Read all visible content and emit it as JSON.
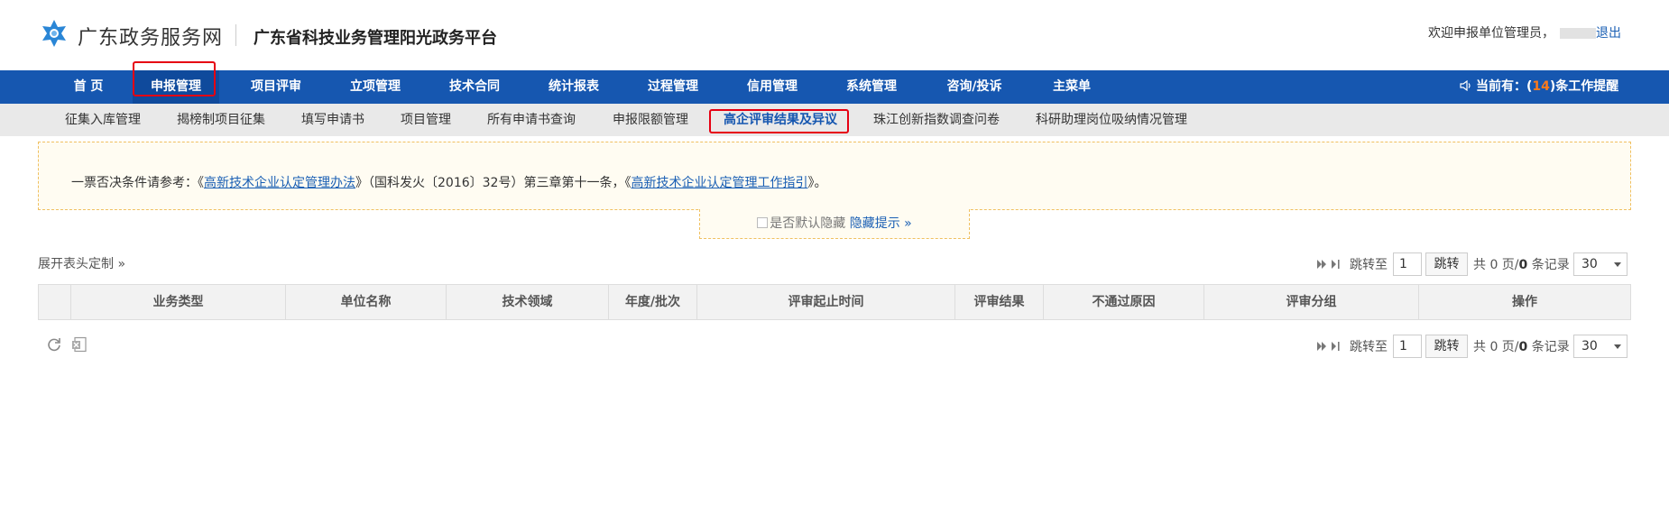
{
  "header": {
    "logo_text": "广东政务服务网",
    "platform_title": "广东省科技业务管理阳光政务平台",
    "welcome": "欢迎申报单位管理员，",
    "logout": "退出"
  },
  "main_nav": {
    "items": [
      "首 页",
      "申报管理",
      "项目评审",
      "立项管理",
      "技术合同",
      "统计报表",
      "过程管理",
      "信用管理",
      "系统管理",
      "咨询/投诉",
      "主菜单"
    ],
    "active": "申报管理"
  },
  "reminder": {
    "prefix": "当前有：(",
    "count": "14",
    "suffix": ")条工作提醒"
  },
  "sub_nav": {
    "items": [
      "征集入库管理",
      "揭榜制项目征集",
      "填写申请书",
      "项目管理",
      "所有申请书查询",
      "申报限额管理",
      "高企评审结果及异议",
      "珠江创新指数调查问卷",
      "科研助理岗位吸纳情况管理"
    ],
    "active": "高企评审结果及异议"
  },
  "notice": {
    "lead": "一票否决条件请参考：《",
    "link1": "高新技术企业认定管理办法",
    "middle": "》（国科发火〔2016〕32号）第三章第十一条，《",
    "link2": "高新技术企业认定管理工作指引",
    "tail": "》。",
    "checkbox_label": "是否默认隐藏",
    "hide_link": "隐藏提示 »"
  },
  "table": {
    "expand_label": "展开表头定制 »",
    "columns": [
      "业务类型",
      "单位名称",
      "技术领域",
      "年度/批次",
      "评审起止时间",
      "评审结果",
      "不通过原因",
      "评审分组",
      "操作"
    ]
  },
  "pager": {
    "jump_to": "跳转至",
    "page_value": "1",
    "jump_button": "跳转",
    "total_prefix": "共 0 页/",
    "total_records": "0",
    "total_suffix": " 条记录",
    "page_size": "30"
  },
  "colors": {
    "nav_bg": "#1657b0",
    "subnav_bg": "#e9e9e9",
    "link": "#1a5fb4",
    "highlight": "#e60012",
    "reminder_count": "#ff7a1a"
  }
}
